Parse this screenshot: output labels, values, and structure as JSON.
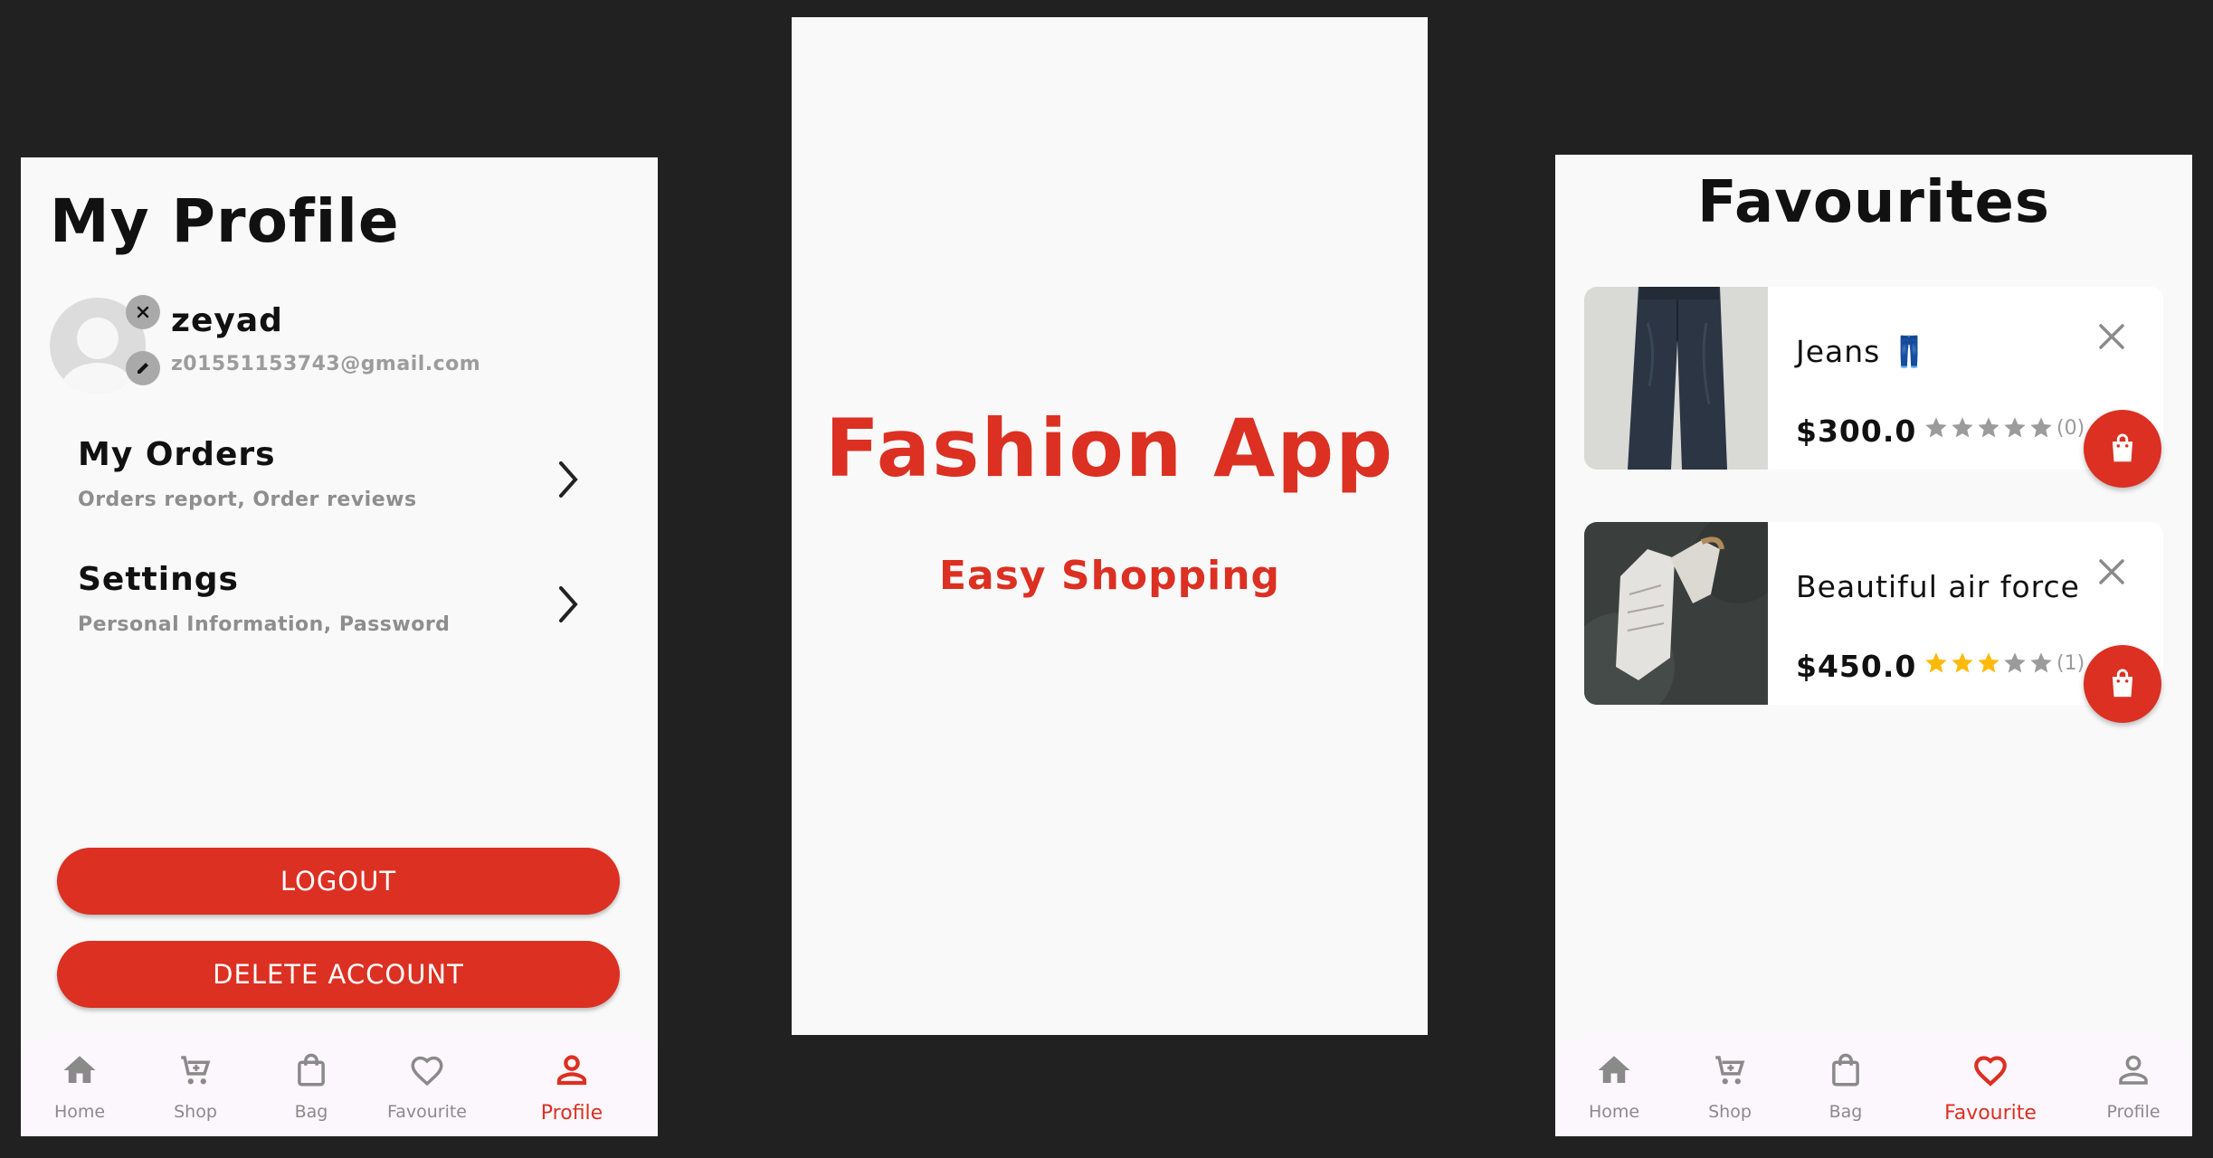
{
  "colors": {
    "accent": "#db3022",
    "background": "#212121",
    "star_filled": "#ffba09",
    "star_empty": "#9b9b9b"
  },
  "profile": {
    "title": "My Profile",
    "user_name": "zeyad",
    "user_email": "z01551153743@gmail.com",
    "menu": [
      {
        "title": "My Orders",
        "subtitle": "Orders report, Order reviews"
      },
      {
        "title": "Settings",
        "subtitle": "Personal Information, Password"
      }
    ],
    "logout_label": "LOGOUT",
    "delete_label": "DELETE ACCOUNT"
  },
  "splash": {
    "title": "Fashion App",
    "subtitle": "Easy Shopping"
  },
  "favourites": {
    "title": "Favourites",
    "items": [
      {
        "name": "Jeans 👖",
        "price": "$300.0",
        "rating": 0,
        "rating_count": "(0)"
      },
      {
        "name": "Beautiful air force",
        "price": "$450.0",
        "rating": 3,
        "rating_count": "(1)"
      }
    ]
  },
  "nav": {
    "items": [
      {
        "label": "Home",
        "icon": "home-icon"
      },
      {
        "label": "Shop",
        "icon": "cart-icon"
      },
      {
        "label": "Bag",
        "icon": "bag-icon"
      },
      {
        "label": "Favourite",
        "icon": "heart-icon"
      },
      {
        "label": "Profile",
        "icon": "person-icon"
      }
    ],
    "profile_screen_active": "Profile",
    "favourites_screen_active": "Favourite"
  }
}
